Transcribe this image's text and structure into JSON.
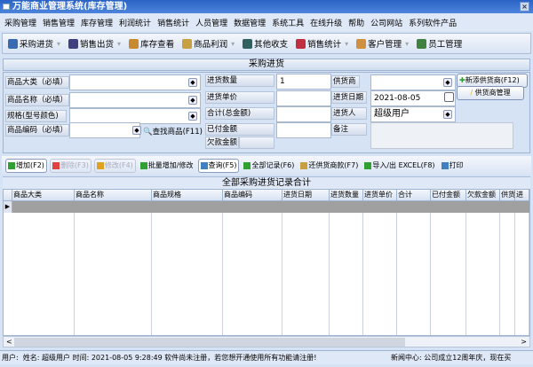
{
  "window": {
    "title": "万能商业管理系统(库存管理)"
  },
  "menu": [
    "采购管理",
    "销售管理",
    "库存管理",
    "利润统计",
    "销售统计",
    "人员管理",
    "数据管理",
    "系统工具",
    "在线升级",
    "帮助",
    "公司网站",
    "系列软件产品"
  ],
  "toolbar": [
    {
      "label": "采购进货",
      "icon": "purchase-icon",
      "color": "#3a6ab0",
      "dropdown": true
    },
    {
      "label": "销售出货",
      "icon": "sales-icon",
      "color": "#404080",
      "dropdown": true
    },
    {
      "label": "库存查看",
      "icon": "box-icon",
      "color": "#c88a30",
      "dropdown": false
    },
    {
      "label": "商品利润",
      "icon": "money-bag-icon",
      "color": "#c8a040",
      "dropdown": true
    },
    {
      "label": "其他收支",
      "icon": "document-icon",
      "color": "#306060",
      "dropdown": false
    },
    {
      "label": "销售统计",
      "icon": "chart-icon",
      "color": "#c03040",
      "dropdown": true
    },
    {
      "label": "客户管理",
      "icon": "customer-icon",
      "color": "#d09040",
      "dropdown": true
    },
    {
      "label": "员工管理",
      "icon": "staff-icon",
      "color": "#408040",
      "dropdown": false
    }
  ],
  "section_title": "采购进货",
  "form": {
    "category_label": "商品大类（必填）",
    "category_value": "",
    "name_label": "商品名称（必填）",
    "name_value": "",
    "spec_label": "规格(型号颜色)",
    "spec_value": "",
    "code_label": "商品编码（必填）",
    "code_value": "",
    "find_product": "查找商品(F11)",
    "qty_label": "进货数量",
    "qty_value": "1",
    "price_label": "进货单价",
    "price_value": "",
    "total_label": "合计(总金额)",
    "total_value": "",
    "paid_label": "已付金额",
    "paid_value": "",
    "owed_label": "欠款金额",
    "owed_value": "",
    "supplier_label": "供货商",
    "supplier_value": "",
    "date_label": "进货日期",
    "date_value": "2021-08-05",
    "buyer_label": "进货人",
    "buyer_value": "超级用户",
    "note_label": "备注",
    "note_value": "",
    "add_supplier": "新添供货商(F12)",
    "manage_supplier": "供货商管理"
  },
  "actions": [
    {
      "label": "增加(F2)",
      "style": "box",
      "color": "#30a030"
    },
    {
      "label": "删除(F3)",
      "style": "dis",
      "color": "#e04040"
    },
    {
      "label": "修改(F4)",
      "style": "dis",
      "color": "#e0a020"
    },
    {
      "label": "批量增加/修改",
      "style": "",
      "color": "#30a030"
    },
    {
      "label": "查询(F5)",
      "style": "box",
      "color": "#4080c0"
    },
    {
      "label": "全部记录(F6)",
      "style": "",
      "color": "#30a030"
    },
    {
      "label": "还供货商款(F7)",
      "style": "",
      "color": "#c8a040"
    },
    {
      "label": "导入/出 EXCEL(F8)",
      "style": "",
      "color": "#30a030"
    },
    {
      "label": "打印",
      "style": "",
      "color": "#4080c0"
    }
  ],
  "grid": {
    "title": "全部采购进货记录合计",
    "columns": [
      "商品大类",
      "商品名称",
      "商品规格",
      "商品编码",
      "进货日期",
      "进货数量",
      "进货单价",
      "合计",
      "已付金额",
      "欠款金额",
      "供货",
      "进"
    ]
  },
  "status": {
    "user": "用户:",
    "name": "姓名: 超级用户",
    "time": "时间: 2021-08-05 9:28:49",
    "notice": "软件尚未注册，若您想开通使用所有功能请注册!",
    "news": "新闻中心: 公司成立12周年庆，现在买"
  }
}
